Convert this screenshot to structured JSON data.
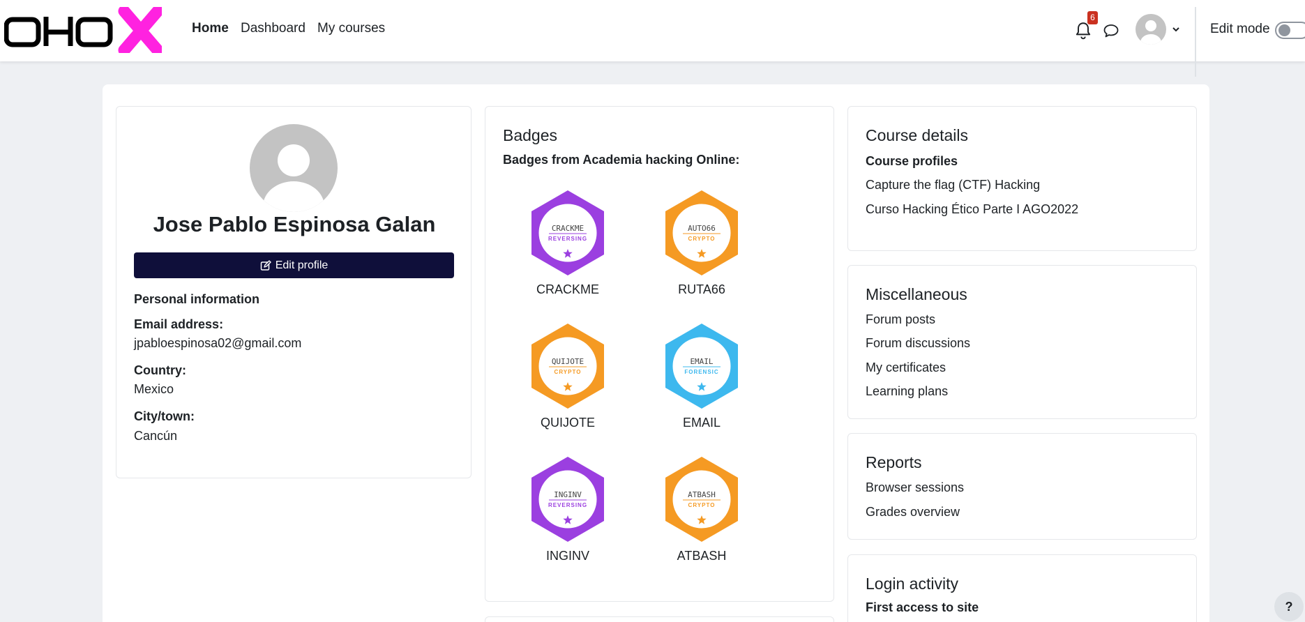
{
  "nav": {
    "logo_alt": "AHO",
    "home": "Home",
    "dashboard": "Dashboard",
    "my_courses": "My courses",
    "notification_count": "6",
    "edit_mode": "Edit mode"
  },
  "profile": {
    "name": "Jose Pablo Espinosa Galan",
    "edit_button": "Edit profile",
    "personal_info": "Personal information",
    "email_label": "Email address:",
    "email_value": "jpabloespinosa02@gmail.com",
    "country_label": "Country:",
    "country_value": "Mexico",
    "city_label": "City/town:",
    "city_value": "Cancún"
  },
  "badges": {
    "title": "Badges",
    "subtitle": "Badges from Academia hacking Online:",
    "items": [
      {
        "name": "CRACKME",
        "logo": "CRACKME",
        "category": "REVERSING",
        "color": "#9b3fe0"
      },
      {
        "name": "RUTA66",
        "logo": "AUTO66",
        "category": "CRYPTO",
        "color": "#f59a23"
      },
      {
        "name": "QUIJOTE",
        "logo": "QUIJOTE",
        "category": "CRYPTO",
        "color": "#f59a23"
      },
      {
        "name": "EMAIL",
        "logo": "EMAIL",
        "category": "FORENSIC",
        "color": "#3db8ee"
      },
      {
        "name": "INGINV",
        "logo": "INGINV",
        "category": "REVERSING",
        "color": "#9b3fe0"
      },
      {
        "name": "ATBASH",
        "logo": "ATBASH",
        "category": "CRYPTO",
        "color": "#f59a23"
      }
    ]
  },
  "course_details": {
    "title": "Course details",
    "heading": "Course profiles",
    "links": [
      "Capture the flag (CTF) Hacking",
      "Curso Hacking Ético Parte I AGO2022"
    ]
  },
  "misc": {
    "title": "Miscellaneous",
    "links": [
      "Forum posts",
      "Forum discussions",
      "My certificates",
      "Learning plans"
    ]
  },
  "reports": {
    "title": "Reports",
    "links": [
      "Browser sessions",
      "Grades overview"
    ]
  },
  "login_activity": {
    "title": "Login activity",
    "heading": "First access to site"
  },
  "help": "?"
}
